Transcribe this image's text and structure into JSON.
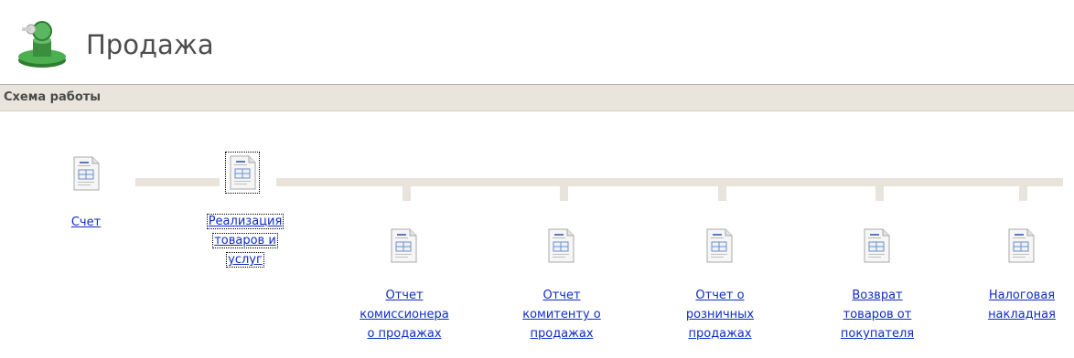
{
  "header": {
    "title": "Продажа",
    "icon": "sales-stamp-icon"
  },
  "section": {
    "title": "Схема работы"
  },
  "documents": {
    "invoice": {
      "label": "Счет"
    },
    "realization": {
      "line1": "Реализация",
      "line2": "товаров и",
      "line3": "услуг"
    },
    "commissioner_report": {
      "line1": "Отчет",
      "line2": "комиссионера",
      "line3": "о продажах"
    },
    "committent_report": {
      "line1": "Отчет",
      "line2": "комитенту о",
      "line3": "продажах"
    },
    "retail_report": {
      "line1": "Отчет о",
      "line2": "розничных",
      "line3": "продажах"
    },
    "buyer_return": {
      "line1": "Возврат",
      "line2": "товаров от",
      "line3": "покупателя"
    },
    "tax_invoice": {
      "line1": "Налоговая",
      "line2": "накладная"
    }
  },
  "colors": {
    "link": "#0f2dc4",
    "section_bar": "#e9e5dc",
    "connector": "#e8e4dc",
    "logo_green": "#3f8f3f"
  }
}
